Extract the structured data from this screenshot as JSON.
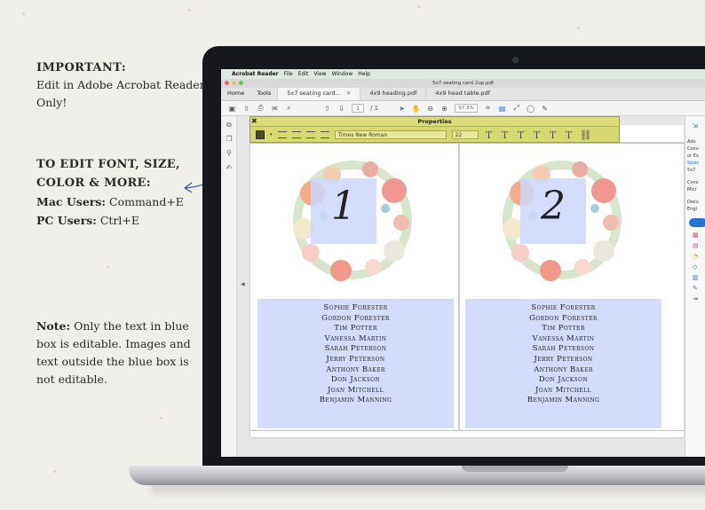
{
  "instructions": {
    "important_heading": "IMPORTANT:",
    "important_text": "Edit in Adobe Acrobat Reader Only!",
    "font_heading": "TO EDIT FONT, SIZE, COLOR & MORE:",
    "mac_label": "Mac Users:",
    "mac_shortcut": "Command+E",
    "pc_label": "PC Users:",
    "pc_shortcut": "Ctrl+E",
    "note_label": "Note:",
    "note_text": "Only the text in blue box is editable. Images and text outside the blue box is not editable."
  },
  "menubar": {
    "app": "Acrobat Reader",
    "items": [
      "File",
      "Edit",
      "View",
      "Window",
      "Help"
    ]
  },
  "window": {
    "title": "5x7 seating card 2up.pdf"
  },
  "tabs": {
    "home": "Home",
    "tools": "Tools",
    "documents": [
      {
        "label": "5x7 seating card..."
      },
      {
        "label": "4x9 heading.pdf"
      },
      {
        "label": "4x9 head table.pdf"
      }
    ]
  },
  "toolbar": {
    "page_current": "1",
    "page_total": "/ 1",
    "zoom": "97.3%"
  },
  "properties_panel": {
    "title": "Properties",
    "font": "Times New Roman",
    "size": "22"
  },
  "cards": [
    {
      "number": "1",
      "names": [
        "Sophie Forester",
        "Gordon Forester",
        "Tim Potter",
        "Vanessa Martin",
        "Sarah Peterson",
        "Jerry Peterson",
        "Anthony Baker",
        "Don Jackson",
        "Joan Mitchell",
        "Benjamin Manning"
      ]
    },
    {
      "number": "2",
      "names": [
        "Sophie Forester",
        "Gordon Forester",
        "Tim Potter",
        "Vanessa Martin",
        "Sarah Peterson",
        "Jerry Peterson",
        "Anthony Baker",
        "Don Jackson",
        "Joan Mitchell",
        "Benjamin Manning"
      ]
    }
  ],
  "right_pane": {
    "lines": [
      "Ado",
      "Conv",
      "or Ex",
      "Selec",
      "5x7",
      "Conv",
      "Micr",
      "Docu",
      "Engl"
    ]
  },
  "colors": {
    "name_box": "#d3dcfb",
    "properties_bg": "#d8d871",
    "arrow": "#2f5f9e",
    "accent_blue": "#2a6fd6"
  }
}
